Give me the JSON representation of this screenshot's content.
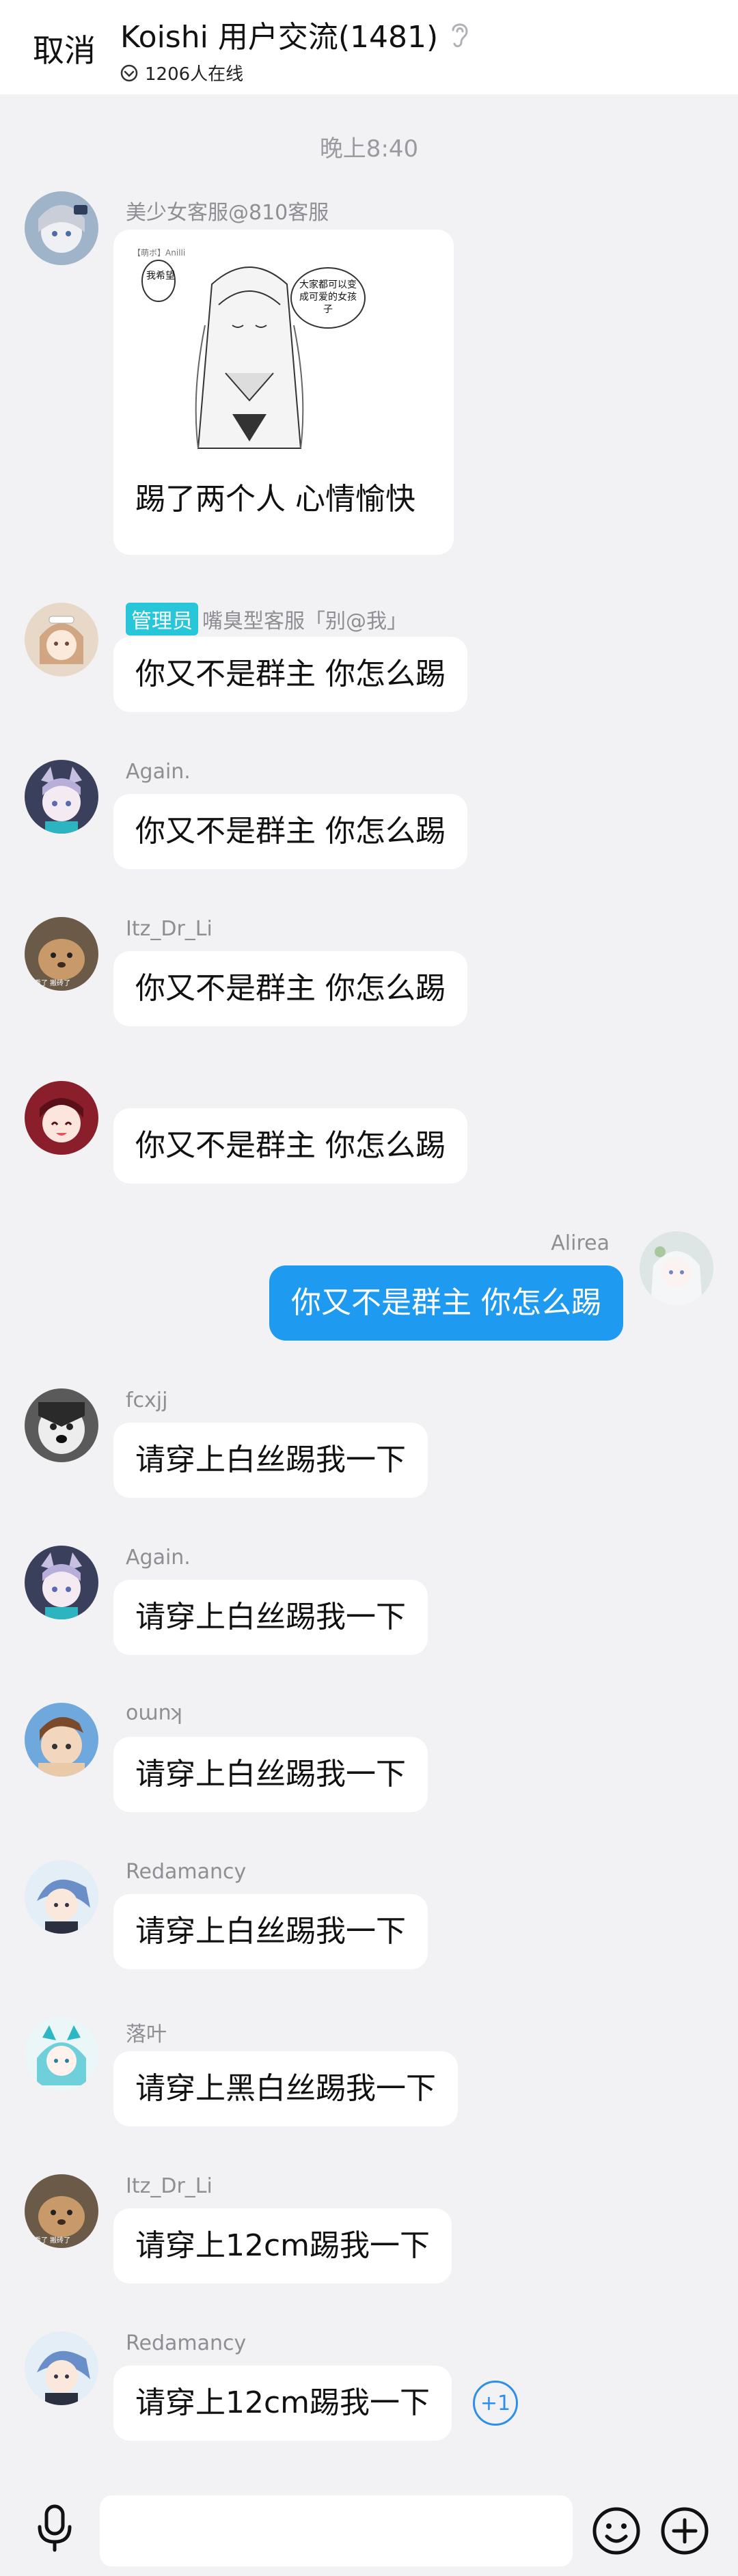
{
  "header": {
    "cancel_label": "取消",
    "title": "Koishi 用户交流(1481)",
    "online_count": "1206人在线"
  },
  "timestamp": "晚上8:40",
  "messages": [
    {
      "sender": "美少女客服@810客服",
      "sticker_texts": [
        "【萌ボ】Anilli",
        "我希望",
        "大家都可以变成可爱的女孩子"
      ],
      "caption": "踢了两个人  心情愉快"
    },
    {
      "badge": "管理员",
      "sender": "嘴臭型客服「别@我」",
      "text": "你又不是群主 你怎么踢"
    },
    {
      "sender": "Again.",
      "text": "你又不是群主 你怎么踢"
    },
    {
      "sender": "Itz_Dr_Li",
      "text": "你又不是群主 你怎么踢",
      "avatar_text": "看了 搬砖了"
    },
    {
      "sender": "",
      "text": "你又不是群主 你怎么踢"
    },
    {
      "sender": "Alirea",
      "text": "你又不是群主 你怎么踢",
      "mine": true
    },
    {
      "sender": "fcxjj",
      "text": "请穿上白丝踢我一下"
    },
    {
      "sender": "Again.",
      "text": "请穿上白丝踢我一下"
    },
    {
      "sender": "kumo",
      "text": "请穿上白丝踢我一下"
    },
    {
      "sender": "Redamancy",
      "text": "请穿上白丝踢我一下"
    },
    {
      "sender": "落叶",
      "text": "请穿上黑白丝踢我一下"
    },
    {
      "sender": "Itz_Dr_Li",
      "text": "请穿上12cm踢我一下",
      "avatar_text": "看了 搬砖了"
    },
    {
      "sender": "Redamancy",
      "text": "请穿上12cm踢我一下",
      "reaction": "+1"
    }
  ],
  "input": {
    "placeholder": ""
  },
  "colors": {
    "accent": "#1E9BF0",
    "admin_badge": "#27C6D8",
    "background": "#F2F2F5",
    "bubble": "#FFFFFF"
  },
  "icons": [
    "ear-icon",
    "online-icon",
    "mic-icon",
    "emoji-icon",
    "plus-icon"
  ]
}
